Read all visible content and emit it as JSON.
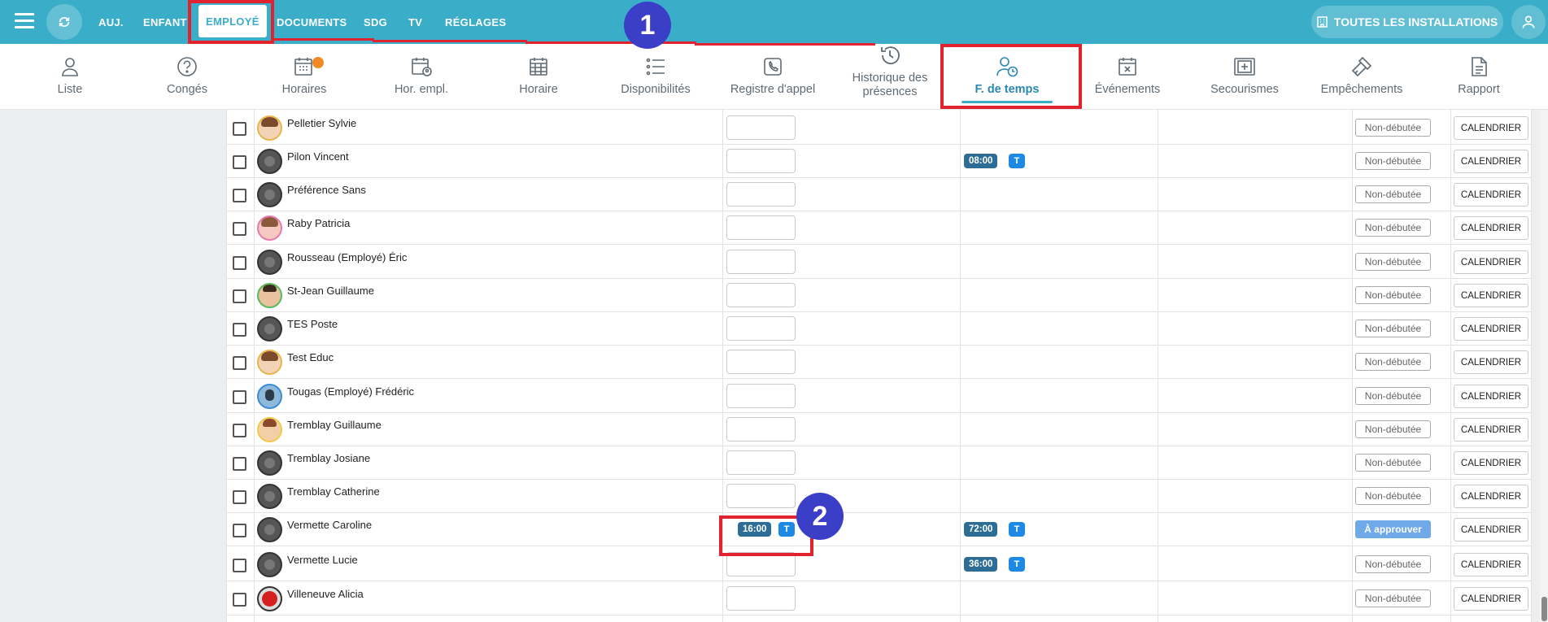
{
  "topnav": {
    "items": [
      "AUJ.",
      "ENFANT",
      "EMPLOYÉ",
      "DOCUMENTS",
      "SDG",
      "TV",
      "RÉGLAGES"
    ],
    "install_label": "TOUTES LES INSTALLATIONS"
  },
  "subnav": {
    "items": [
      {
        "label": "Liste",
        "icon": "person-icon"
      },
      {
        "label": "Congés",
        "icon": "question-circle-icon"
      },
      {
        "label": "Horaires",
        "icon": "calendar-star-icon"
      },
      {
        "label": "Hor. empl.",
        "icon": "calendar-person-icon"
      },
      {
        "label": "Horaire",
        "icon": "calendar-grid-icon"
      },
      {
        "label": "Disponibilités",
        "icon": "list-icon"
      },
      {
        "label": "Registre d'appel",
        "icon": "phone-icon"
      },
      {
        "label": "Historique des présences",
        "icon": "history-icon"
      },
      {
        "label": "F. de temps",
        "icon": "person-clock-icon"
      },
      {
        "label": "Événements",
        "icon": "calendar-x-icon"
      },
      {
        "label": "Secourismes",
        "icon": "first-aid-icon"
      },
      {
        "label": "Empêchements",
        "icon": "hammer-icon"
      },
      {
        "label": "Rapport",
        "icon": "document-icon"
      }
    ]
  },
  "rows": [
    {
      "name": "Pelletier Sylvie",
      "avatar": "face",
      "status": "Non-débutée"
    },
    {
      "name": "Pilon Vincent",
      "avatar": "default",
      "week": "08:00",
      "status": "Non-débutée"
    },
    {
      "name": "Préférence Sans",
      "avatar": "default",
      "status": "Non-débutée"
    },
    {
      "name": "Raby Patricia",
      "avatar": "pink",
      "status": "Non-débutée"
    },
    {
      "name": "Rousseau (Employé) Éric",
      "avatar": "default",
      "status": "Non-débutée"
    },
    {
      "name": "St-Jean Guillaume",
      "avatar": "green",
      "status": "Non-débutée"
    },
    {
      "name": "TES Poste",
      "avatar": "default",
      "status": "Non-débutée"
    },
    {
      "name": "Test Educ",
      "avatar": "face",
      "status": "Non-débutée"
    },
    {
      "name": "Tougas (Employé) Frédéric",
      "avatar": "blue",
      "status": "Non-débutée"
    },
    {
      "name": "Tremblay Guillaume",
      "avatar": "yellowb",
      "status": "Non-débutée"
    },
    {
      "name": "Tremblay Josiane",
      "avatar": "default",
      "status": "Non-débutée"
    },
    {
      "name": "Tremblay Catherine",
      "avatar": "default",
      "status": "Non-débutée"
    },
    {
      "name": "Vermette Caroline",
      "avatar": "default",
      "day": "16:00",
      "week": "72:00",
      "status": "À approuver"
    },
    {
      "name": "Vermette Lucie",
      "avatar": "default",
      "week": "36:00",
      "status": "Non-débutée"
    },
    {
      "name": "Villeneuve Alicia",
      "avatar": "red",
      "status": "Non-débutée"
    }
  ],
  "badge_t": "T",
  "calendar_label": "CALENDRIER",
  "callouts": [
    "1",
    "2"
  ],
  "colors": {
    "primary": "#3aaec9",
    "highlight": "#e0232f",
    "callout": "#3b3fc8",
    "time_badge": "#2d6d95",
    "t_badge": "#1e88e5",
    "approve": "#6fa9e8"
  }
}
